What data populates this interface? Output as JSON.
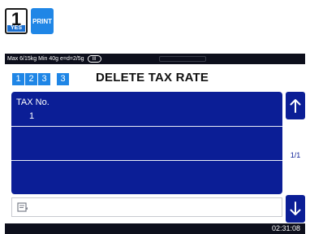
{
  "keys": {
    "one": {
      "digit": "1",
      "sub": "YES"
    },
    "print": {
      "label": "PRINT"
    }
  },
  "status": {
    "text": "Max 6/15kg Min 40g e=d=2/5g",
    "range_badge": "III"
  },
  "steps": [
    "1",
    "2",
    "3",
    "3"
  ],
  "title": "DELETE TAX RATE",
  "list": {
    "header": "TAX No.",
    "rows": [
      {
        "value": "1"
      },
      {
        "value": ""
      },
      {
        "value": ""
      }
    ]
  },
  "pager": {
    "label": "1/1"
  },
  "icons": {
    "up": "arrow-up-icon",
    "down": "arrow-down-icon",
    "note": "note-icon"
  },
  "clock": "02:31:08",
  "colors": {
    "accent_blue": "#1f86e6",
    "list_navy": "#0b1e96",
    "bar_dark": "#0d0f1c"
  }
}
